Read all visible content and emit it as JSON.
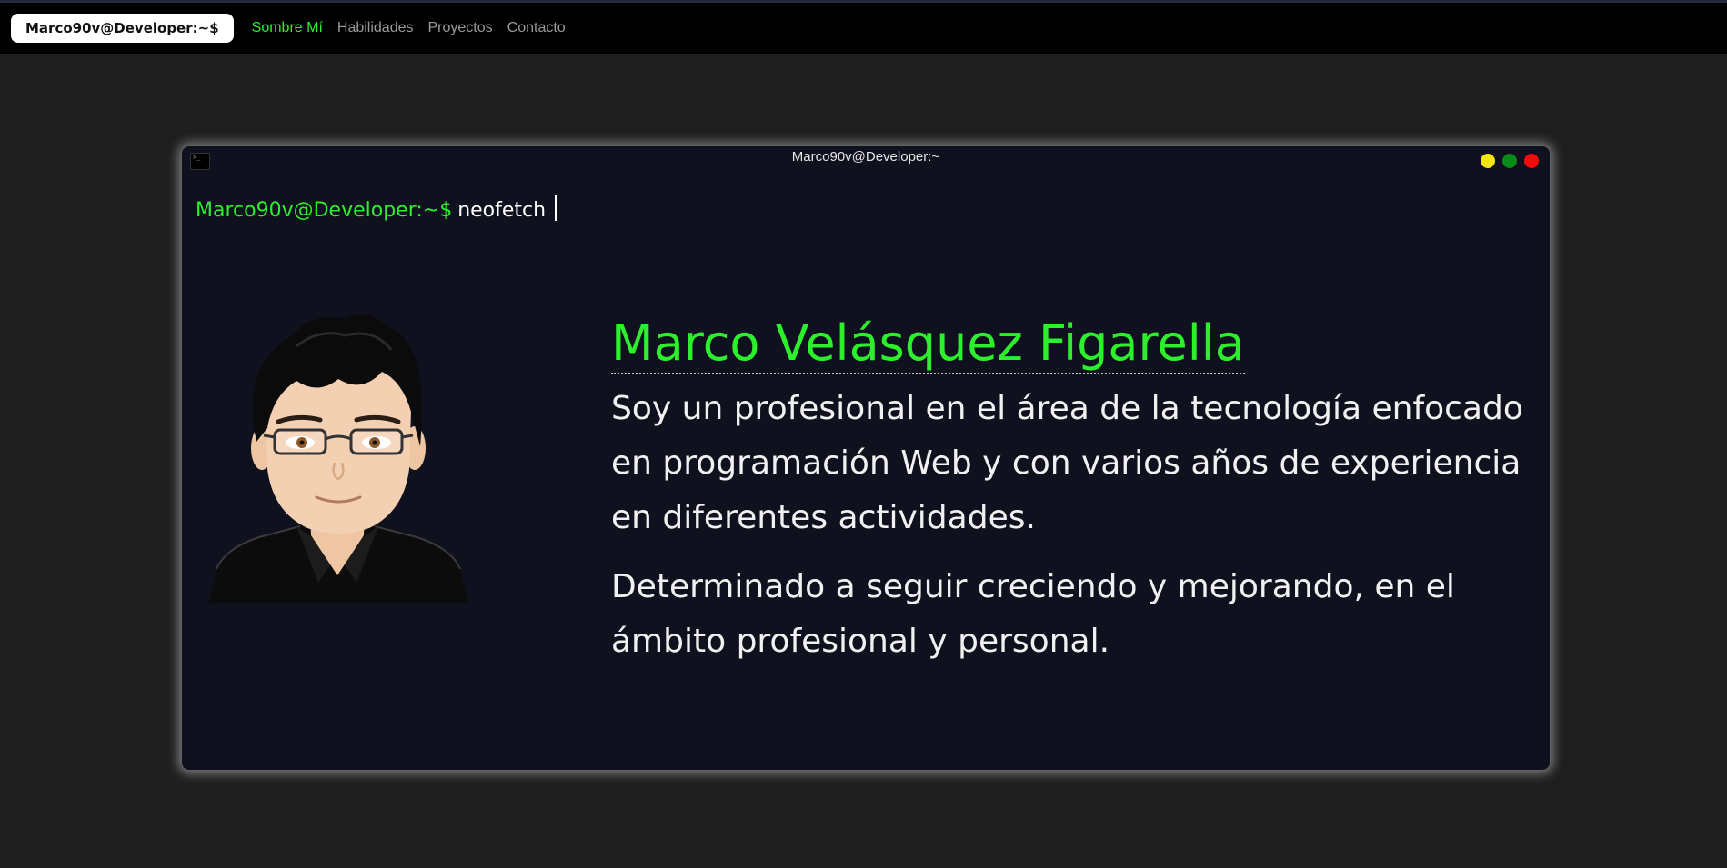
{
  "navbar": {
    "brand": "Marco90v@Developer:~$",
    "links": [
      {
        "label": "Sombre Mí"
      },
      {
        "label": "Habilidades"
      },
      {
        "label": "Proyectos"
      },
      {
        "label": "Contacto"
      }
    ],
    "active_color": "#2cf02c"
  },
  "terminal": {
    "title": "Marco90v@Developer:~",
    "icon": "terminal-icon",
    "prompt": "Marco90v@Developer:~$",
    "command": "neofetch",
    "window_controls": [
      "yellow-dot",
      "green-dot",
      "red-dot"
    ]
  },
  "profile": {
    "avatar": "avatar-illustration",
    "name": "Marco Velásquez Figarella",
    "paragraphs": [
      "Soy un profesional en el área de la tecnología enfocado en programación Web y con varios años de experiencia en diferentes actividades.",
      "Determinado a seguir creciendo y mejorando, en el ámbito profesional y personal."
    ]
  },
  "colors": {
    "accent": "#2cf02c",
    "terminal_bg": "#10111e",
    "page_bg": "#1e1e1e"
  }
}
